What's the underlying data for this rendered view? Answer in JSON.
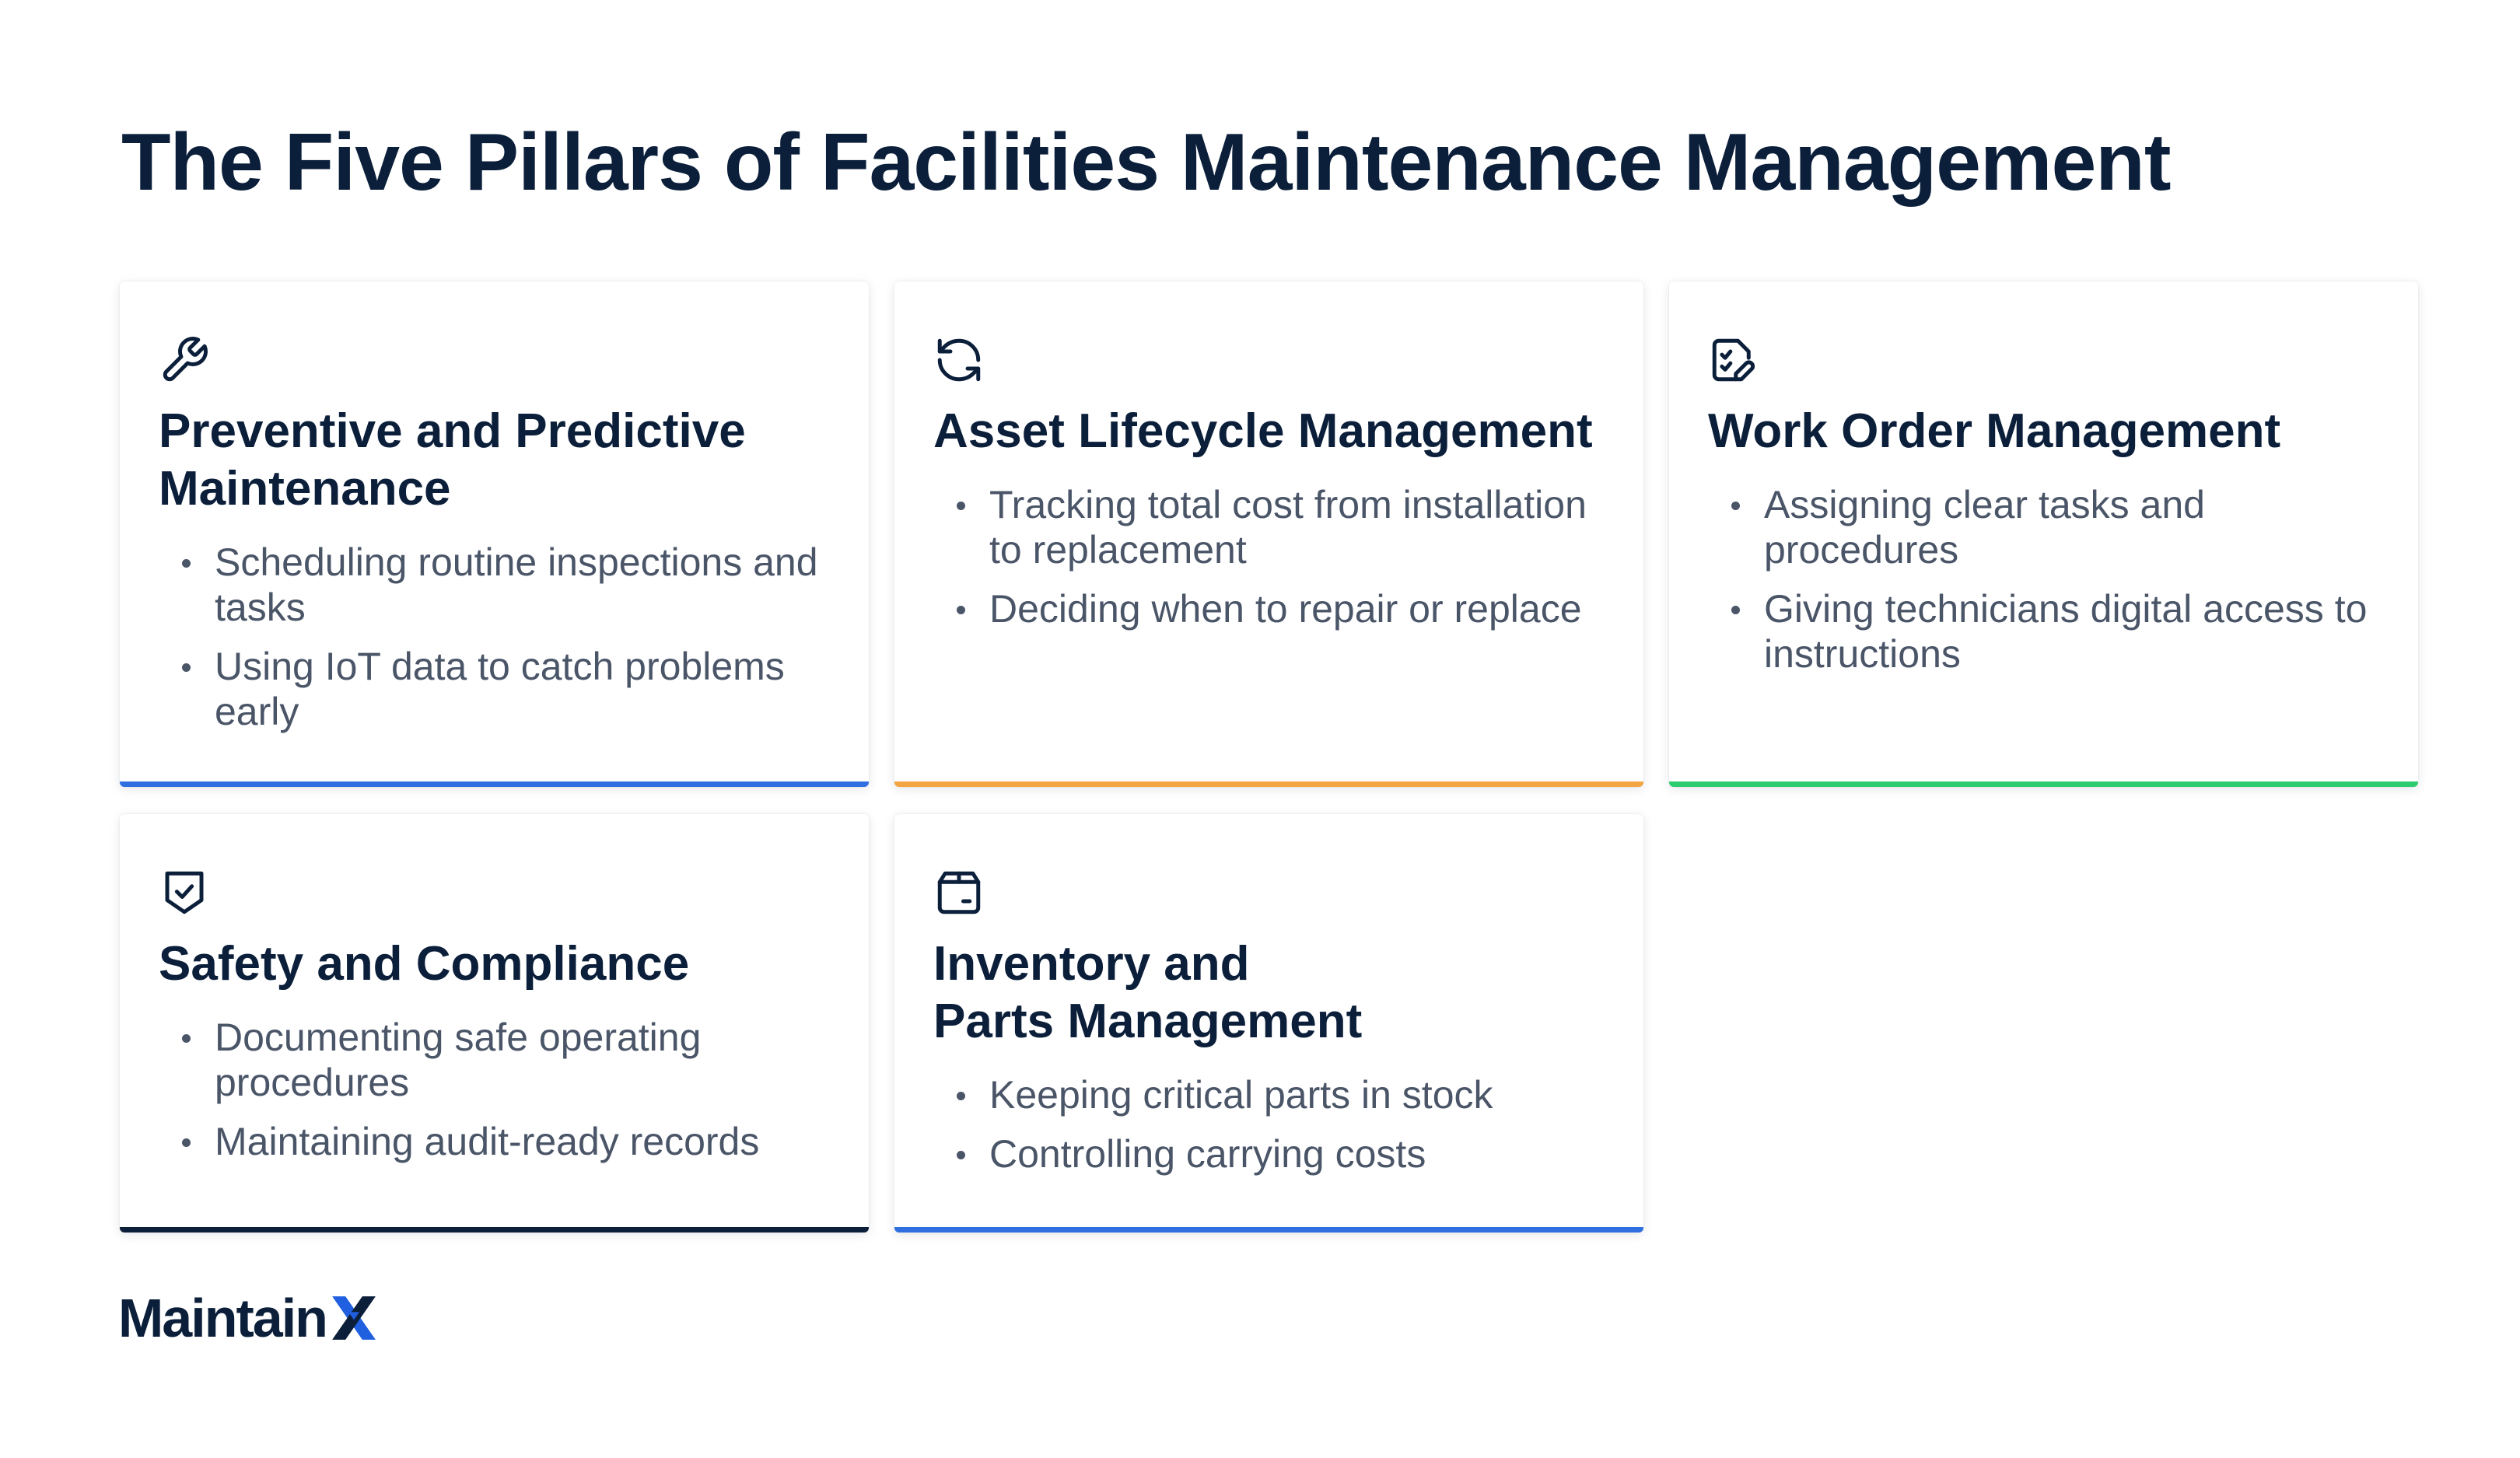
{
  "title": "The Five Pillars of Facilities Maintenance Management",
  "cards": [
    {
      "icon": "wrench-icon",
      "accent": "#2f6fe0",
      "title": "Preventive and Predictive\nMaintenance",
      "bullets": [
        "Scheduling routine inspections and tasks",
        "Using IoT data to catch problems early"
      ]
    },
    {
      "icon": "refresh-cycle-icon",
      "accent": "#f2a541",
      "title": "Asset Lifecycle Management",
      "bullets": [
        "Tracking total cost from installation to replacement",
        "Deciding when to repair or replace"
      ]
    },
    {
      "icon": "checklist-edit-icon",
      "accent": "#2ecc71",
      "title": "Work Order Management",
      "bullets": [
        "Assigning clear tasks and procedures",
        "Giving technicians digital access to instructions"
      ]
    },
    {
      "icon": "shield-check-icon",
      "accent": "#0b1f3a",
      "title": "Safety and Compliance",
      "bullets": [
        "Documenting safe operating procedures",
        "Maintaining audit-ready records"
      ]
    },
    {
      "icon": "parts-box-icon",
      "accent": "#2f6fe0",
      "title": "Inventory and\nParts Management",
      "bullets": [
        "Keeping critical parts in stock",
        "Controlling carrying costs"
      ]
    }
  ],
  "brand": {
    "name": "Maintain",
    "accent": "#1f5fe0"
  }
}
